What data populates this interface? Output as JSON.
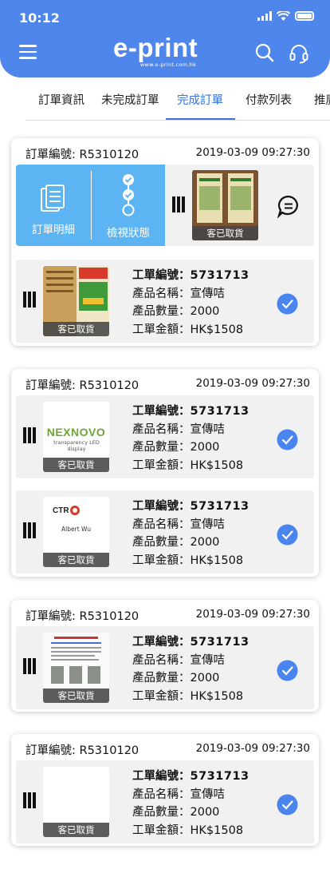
{
  "status_bar": {
    "time": "10:12"
  },
  "header": {
    "logo": "e-print",
    "logo_sub": "www.e-print.com.hk"
  },
  "tabs": [
    {
      "label": "訂單資訊",
      "active": false
    },
    {
      "label": "未完成訂單",
      "active": false
    },
    {
      "label": "完成訂單",
      "active": true
    },
    {
      "label": "付款列表",
      "active": false
    },
    {
      "label": "推廣",
      "active": false
    }
  ],
  "labels": {
    "order_no": "訂單編號:",
    "job_no": "工單編號：",
    "product_name": "產品名稱：",
    "product_qty": "產品數量：",
    "job_amount": "工單金額：",
    "picked_up": "客已取貨",
    "order_detail": "訂單明細",
    "view_status": "檢視狀態"
  },
  "colors": {
    "brand": "#4f86ec",
    "action": "#5db4f3",
    "active_tab": "#3b72dc",
    "check": "#4a84ee"
  },
  "orders": [
    {
      "order_no": "R5310120",
      "date": "2019-03-09 09:27:30",
      "items": [
        {
          "job_no": "5731713",
          "product": "宣傳咭",
          "qty": "2000",
          "amount": "HK$1508",
          "status": "客已取貨"
        }
      ]
    },
    {
      "order_no": "R5310120",
      "date": "2019-03-09 09:27:30",
      "items": [
        {
          "job_no": "5731713",
          "product": "宣傳咭",
          "qty": "2000",
          "amount": "HK$1508",
          "status": "客已取貨",
          "thumb_text": "NEXNOVO",
          "thumb_sub": "transparency LED display"
        },
        {
          "job_no": "5731713",
          "product": "宣傳咭",
          "qty": "2000",
          "amount": "HK$1508",
          "status": "客已取貨",
          "thumb_text": "CTR",
          "thumb_sub": "Albert Wu"
        }
      ]
    },
    {
      "order_no": "R5310120",
      "date": "2019-03-09 09:27:30",
      "items": [
        {
          "job_no": "5731713",
          "product": "宣傳咭",
          "qty": "2000",
          "amount": "HK$1508",
          "status": "客已取貨"
        }
      ]
    },
    {
      "order_no": "R5310120",
      "date": "2019-03-09 09:27:30",
      "items": [
        {
          "job_no": "5731713",
          "product": "宣傳咭",
          "qty": "2000",
          "amount": "HK$1508",
          "status": "客已取貨"
        }
      ]
    }
  ]
}
